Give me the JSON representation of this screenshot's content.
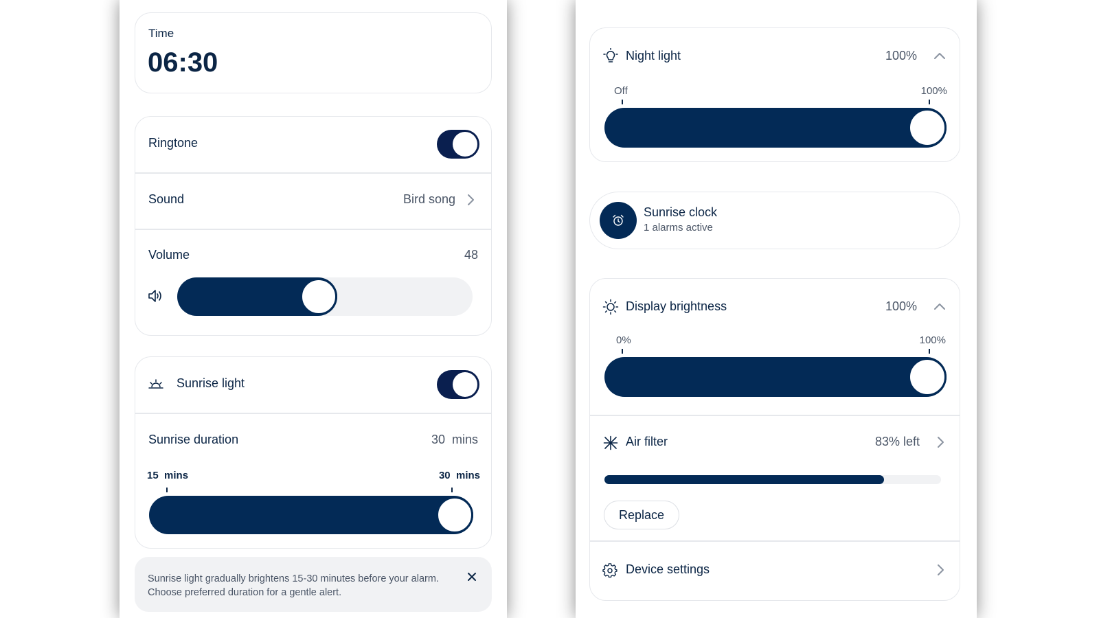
{
  "left": {
    "time": {
      "label": "Time",
      "value": "06:30"
    },
    "ringtone": {
      "label": "Ringtone",
      "on": true
    },
    "sound": {
      "label": "Sound",
      "value": "Bird song"
    },
    "volume": {
      "label": "Volume",
      "value": "48",
      "level": 48,
      "max": 100
    },
    "sunrise_light": {
      "label": "Sunrise light",
      "on": true
    },
    "sunrise_duration": {
      "label": "Sunrise duration",
      "value_num": "30",
      "value_unit": "mins",
      "min_num": "15",
      "min_unit": "mins",
      "max_num": "30",
      "max_unit": "mins",
      "level": 1.0
    },
    "info": {
      "text": "Sunrise light gradually brightens 15-30 minutes before your alarm. Choose preferred duration for a gentle alert."
    }
  },
  "right": {
    "night_light": {
      "label": "Night light",
      "value": "100%",
      "min_label": "Off",
      "max_label": "100%",
      "level": 1.0
    },
    "sunrise_clock": {
      "title": "Sunrise clock",
      "subtitle": "1 alarms active"
    },
    "display_brightness": {
      "label": "Display brightness",
      "value": "100%",
      "min_label": "0%",
      "max_label": "100%",
      "level": 1.0
    },
    "air_filter": {
      "label": "Air filter",
      "value": "83% left",
      "level": 0.83,
      "button": "Replace"
    },
    "device_settings": {
      "label": "Device settings"
    }
  },
  "colors": {
    "primary": "#032a56",
    "toggle": "#0a1f4f",
    "text": "#0b2545",
    "muted": "#4a5566",
    "track": "#f1f2f4",
    "border": "#e6e8ec"
  }
}
